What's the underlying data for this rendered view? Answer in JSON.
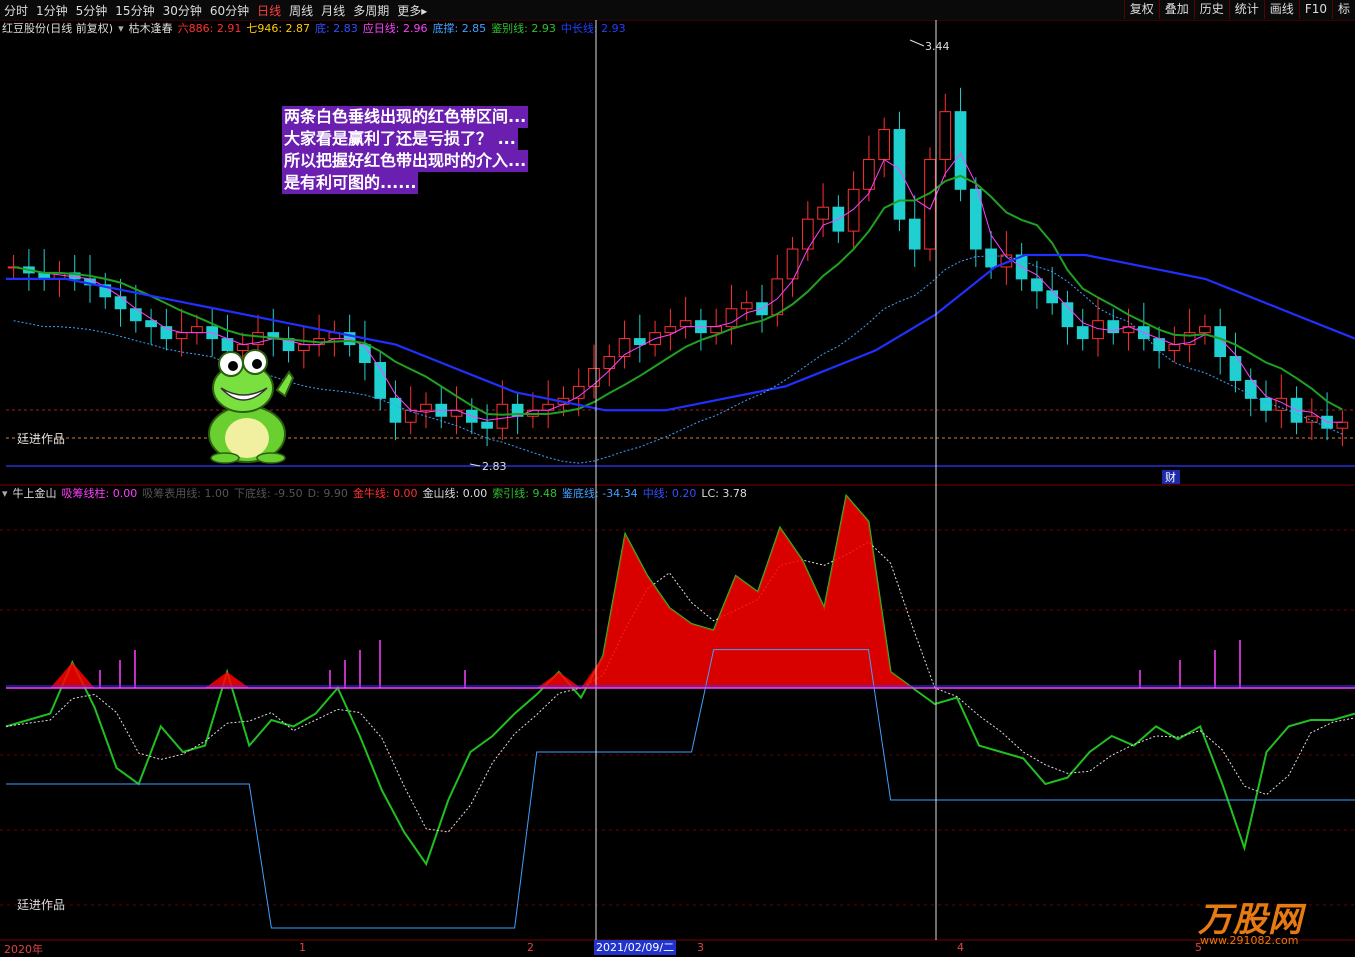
{
  "toolbar": {
    "periods": [
      "分时",
      "1分钟",
      "5分钟",
      "15分钟",
      "30分钟",
      "60分钟",
      "日线",
      "周线",
      "月线",
      "多周期",
      "更多"
    ],
    "active": "日线",
    "more_arrow": "▸",
    "right_buttons": [
      "复权",
      "叠加",
      "历史",
      "统计",
      "画线",
      "F10",
      "标"
    ]
  },
  "main_legend": {
    "triangle_icon": "▾",
    "stock": "红豆股份(日线 前复权)",
    "formula": "枯木逢春",
    "items": [
      {
        "label": "六886:",
        "value": "2.91",
        "color": "#ff3030"
      },
      {
        "label": "七946:",
        "value": "2.87",
        "color": "#ffcc00"
      },
      {
        "label": "底:",
        "value": "2.83",
        "color": "#3050ff"
      },
      {
        "label": "应日线:",
        "value": "2.96",
        "color": "#ff40ff"
      },
      {
        "label": "底撑:",
        "value": "2.85",
        "color": "#40a0ff"
      },
      {
        "label": "鉴别线:",
        "value": "2.93",
        "color": "#30c030"
      },
      {
        "label": "中长线:",
        "value": "2.93",
        "color": "#2040ff"
      }
    ]
  },
  "annotation": {
    "lines": [
      "两条白色垂线出现的红色带区间...",
      "大家看是赢利了还是亏损了？ ...",
      "所以把握好红色带出现时的介入...",
      "是有利可图的......"
    ]
  },
  "price_marks": {
    "high": "3.44",
    "low": "2.83",
    "cai": "财"
  },
  "watermark": "廷进作品",
  "sub_legend": {
    "triangle_icon": "▾",
    "formula": "牛上金山",
    "items": [
      {
        "label": "吸筹线柱:",
        "value": "0.00",
        "color": "#ff40ff"
      },
      {
        "label": "吸筹表用线:",
        "value": "1.00",
        "color": "#666"
      },
      {
        "label": "下底线:",
        "value": "-9.50",
        "color": "#666"
      },
      {
        "label": "D:",
        "value": "9.90",
        "color": "#666"
      },
      {
        "label": "金牛线:",
        "value": "0.00",
        "color": "#ff3030"
      },
      {
        "label": "金山线:",
        "value": "0.00",
        "color": "#dddddd"
      },
      {
        "label": "索引线:",
        "value": "9.48",
        "color": "#30c030"
      },
      {
        "label": "鉴底线:",
        "value": "-34.34",
        "color": "#40a0ff"
      },
      {
        "label": "中线:",
        "value": "0.20",
        "color": "#3050ff"
      },
      {
        "label": "LC:",
        "value": "3.78",
        "color": "#dddddd"
      }
    ]
  },
  "x_axis": {
    "labels": [
      "2020年",
      "1",
      "2",
      "3",
      "4",
      "5"
    ],
    "cursor_date": "2021/02/09/二"
  },
  "logo": {
    "text": "万股网",
    "sub": "www.291082.com"
  },
  "colors": {
    "up": "#ff3030",
    "down": "#20d0d0",
    "ma_blue": "#2030ff",
    "ma_green": "#20a020",
    "ma_pink": "#ff40ff",
    "support": "#40a0ff"
  },
  "chart_data": {
    "type": "candlestick",
    "ylim": [
      2.78,
      3.5
    ],
    "guides": {
      "high_mark": 3.44,
      "low_mark": 2.83
    },
    "candles_close": [
      3.12,
      3.11,
      3.1,
      3.11,
      3.1,
      3.09,
      3.07,
      3.05,
      3.03,
      3.02,
      3.0,
      3.01,
      3.02,
      3.0,
      2.98,
      2.99,
      3.01,
      3.0,
      2.98,
      2.99,
      3.0,
      3.01,
      2.99,
      2.96,
      2.9,
      2.86,
      2.88,
      2.89,
      2.87,
      2.88,
      2.86,
      2.85,
      2.89,
      2.87,
      2.88,
      2.89,
      2.9,
      2.92,
      2.95,
      2.97,
      3.0,
      2.99,
      3.01,
      3.02,
      3.03,
      3.01,
      3.02,
      3.05,
      3.06,
      3.04,
      3.1,
      3.15,
      3.2,
      3.22,
      3.18,
      3.25,
      3.3,
      3.35,
      3.2,
      3.15,
      3.3,
      3.38,
      3.25,
      3.15,
      3.12,
      3.14,
      3.1,
      3.08,
      3.06,
      3.02,
      3.0,
      3.03,
      3.01,
      3.02,
      3.0,
      2.98,
      2.99,
      3.01,
      3.02,
      2.97,
      2.93,
      2.9,
      2.88,
      2.9,
      2.86,
      2.87,
      2.85,
      2.86
    ],
    "ma_long": [
      3.1,
      3.1,
      3.1,
      3.09,
      3.08,
      3.07,
      3.06,
      3.05,
      3.04,
      3.03,
      3.02,
      3.01,
      3.0,
      2.99,
      2.97,
      2.95,
      2.93,
      2.91,
      2.9,
      2.89,
      2.88,
      2.88,
      2.88,
      2.89,
      2.9,
      2.91,
      2.92,
      2.94,
      2.96,
      2.98,
      3.01,
      3.04,
      3.08,
      3.12,
      3.14,
      3.14,
      3.14,
      3.13,
      3.12,
      3.11,
      3.1,
      3.08,
      3.06,
      3.04,
      3.02,
      3.0
    ],
    "osc_green": [
      -12,
      -10,
      -8,
      8,
      -6,
      -25,
      -30,
      -12,
      -20,
      -18,
      5,
      -18,
      -10,
      -12,
      -8,
      0,
      -15,
      -32,
      -45,
      -55,
      -35,
      -20,
      -15,
      -8,
      -2,
      5,
      -3,
      10,
      48,
      35,
      25,
      20,
      18,
      35,
      30,
      50,
      40,
      25,
      60,
      52,
      5,
      0,
      -5,
      -3,
      -18,
      -20,
      -22,
      -30,
      -28,
      -20,
      -15,
      -18,
      -12,
      -16,
      -12,
      -30,
      -50,
      -20,
      -12,
      -10,
      -10,
      -8
    ]
  }
}
